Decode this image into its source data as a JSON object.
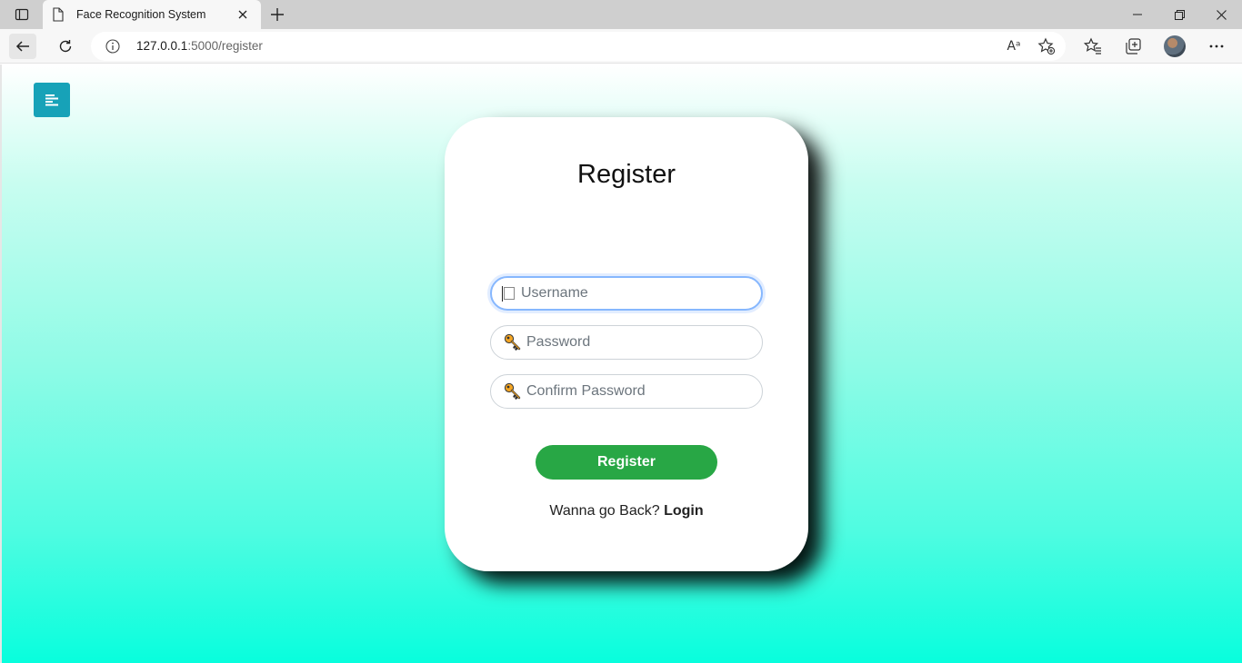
{
  "browser": {
    "tab": {
      "title": "Face Recognition System"
    },
    "address": {
      "host": "127.0.0.1",
      "path": ":5000/register"
    },
    "read_aloud_glyph": "Aᵃ"
  },
  "page": {
    "colors": {
      "gradient_top": "#ffffff",
      "gradient_bottom": "#08fedd",
      "menu_button": "#17a2b8",
      "register_button": "#28a745"
    },
    "menu_button_icon": "align-left-icon",
    "form": {
      "title": "Register",
      "username_placeholder": "Username",
      "password_placeholder": "Password",
      "confirm_placeholder": "Confirm Password",
      "submit_label": "Register",
      "back_prompt": "Wanna go Back?",
      "login_link": "Login"
    }
  }
}
